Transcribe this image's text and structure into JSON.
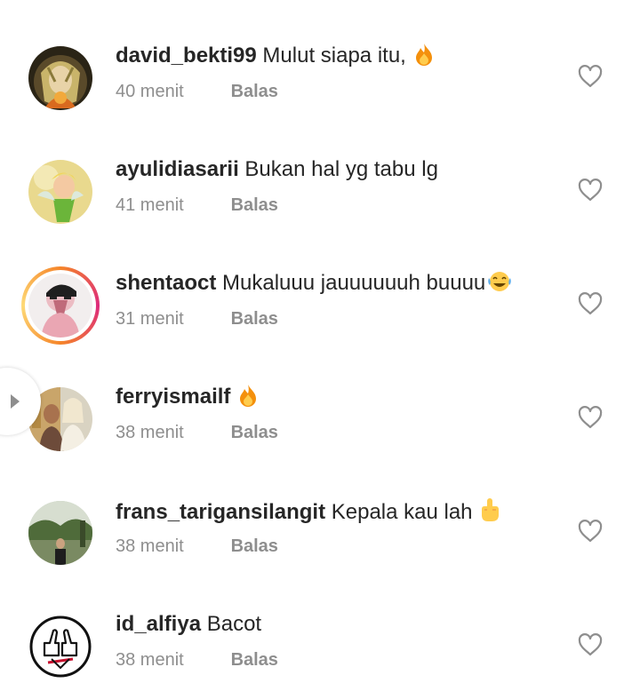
{
  "comments": [
    {
      "username": "david_bekti99",
      "text": "Mulut siapa itu,",
      "emoji": "fire-emoji",
      "time": "40 menit",
      "reply": "Balas",
      "avatar": "avatar-anime-fire"
    },
    {
      "username": "ayulidiasarii",
      "text": "Bukan hal yg tabu lg",
      "emoji": "",
      "time": "41 menit",
      "reply": "Balas",
      "avatar": "avatar-fairy"
    },
    {
      "username": "shentaoct",
      "text": "Mukaluuu jauuuuuuh buuuu",
      "emoji": "laughing-emoji",
      "time": "31 menit",
      "reply": "Balas",
      "avatar": "avatar-hijab-illustration",
      "story_ring": true
    },
    {
      "username": "ferryismailf",
      "text": "",
      "emoji": "fire-emoji",
      "time": "38 menit",
      "reply": "Balas",
      "avatar": "avatar-photo-couple"
    },
    {
      "username": "frans_tarigansilangit",
      "text": "Kepala kau lah",
      "emoji": "middle-finger-emoji",
      "time": "38 menit",
      "reply": "Balas",
      "avatar": "avatar-photo-park"
    },
    {
      "username": "id_alfiya",
      "text": "Bacot",
      "emoji": "",
      "time": "38 menit",
      "reply": "Balas",
      "avatar": "avatar-thumbs-up-logo"
    }
  ],
  "icons": {
    "like": "heart-outline-icon",
    "side_handle": "play-arrow-icon"
  },
  "colors": {
    "text": "#262626",
    "secondary": "#8e8e8e",
    "story_ring_start": "#f58529",
    "story_ring_end": "#dd2a7b"
  }
}
